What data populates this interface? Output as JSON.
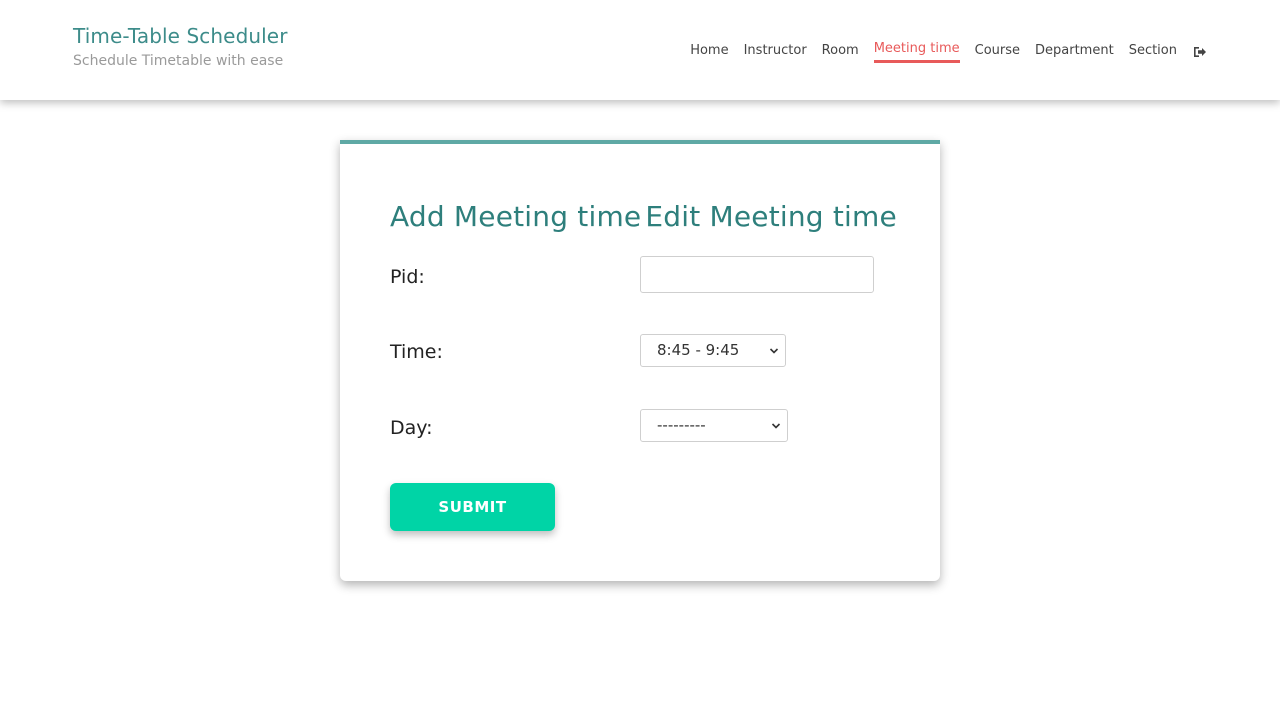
{
  "brand": {
    "title": "Time-Table Scheduler",
    "subtitle": "Schedule Timetable with ease"
  },
  "nav": {
    "items": [
      {
        "label": "Home"
      },
      {
        "label": "Instructor"
      },
      {
        "label": "Room"
      },
      {
        "label": "Meeting time",
        "active": true
      },
      {
        "label": "Course"
      },
      {
        "label": "Department"
      },
      {
        "label": "Section"
      }
    ],
    "logout_icon": "sign-out-icon"
  },
  "form": {
    "title_add": "Add Meeting time",
    "title_edit": "Edit Meeting time",
    "pid_label": "Pid:",
    "pid_value": "",
    "time_label": "Time:",
    "time_selected": "8:45 - 9:45",
    "day_label": "Day:",
    "day_selected": "---------",
    "submit_label": "SUBMIT"
  },
  "colors": {
    "accent_teal": "#3d8c8a",
    "active_nav": "#e85a5a",
    "card_border": "#5fa9a5",
    "submit_bg": "#00d4a6"
  }
}
